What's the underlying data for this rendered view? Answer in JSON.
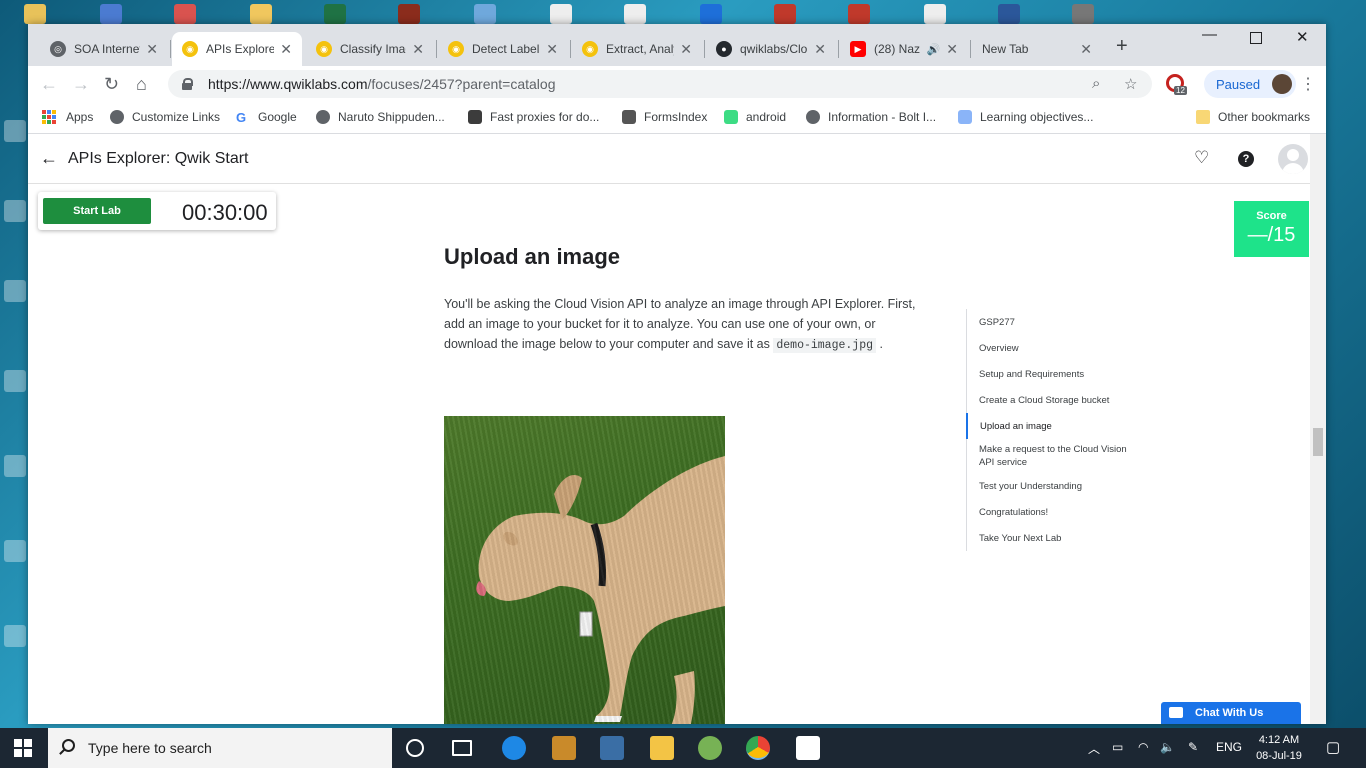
{
  "browser": {
    "tabs": [
      {
        "label": "SOA Internet",
        "active": false
      },
      {
        "label": "APIs Explorer",
        "active": true
      },
      {
        "label": "Classify Imag",
        "active": false
      },
      {
        "label": "Detect Label",
        "active": false
      },
      {
        "label": "Extract, Analy",
        "active": false
      },
      {
        "label": "qwiklabs/Clo",
        "active": false
      },
      {
        "label": "(28) Naz",
        "active": false
      },
      {
        "label": "New Tab",
        "active": false
      }
    ],
    "url_host": "https://www.qwiklabs.com",
    "url_path": "/focuses/2457?parent=catalog",
    "profile_status": "Paused",
    "extension_badge": "12",
    "bookmarks": [
      "Apps",
      "Customize Links",
      "Google",
      "Naruto Shippuden...",
      "Fast proxies for do...",
      "FormsIndex",
      "android",
      "Information - Bolt I...",
      "Learning objectives..."
    ],
    "other_bookmarks": "Other bookmarks"
  },
  "page": {
    "title": "APIs Explorer: Qwik Start",
    "start_lab": "Start Lab",
    "timer": "00:30:00",
    "score_label": "Score",
    "score_value": "—/15",
    "heading": "Upload an image",
    "paragraph_before": "You'll be asking the Cloud Vision API to analyze an image through API Explorer. First, add an image to your bucket for it to analyze. You can use one of your own, or download the image below to your computer and save it as",
    "code_filename": "demo-image.jpg",
    "paragraph_after": ".",
    "toc": [
      {
        "label": "GSP277",
        "active": false
      },
      {
        "label": "Overview",
        "active": false
      },
      {
        "label": "Setup and Requirements",
        "active": false
      },
      {
        "label": "Create a Cloud Storage bucket",
        "active": false
      },
      {
        "label": "Upload an image",
        "active": true
      },
      {
        "label": "Make a request to the Cloud Vision API service",
        "active": false
      },
      {
        "label": "Test your Understanding",
        "active": false
      },
      {
        "label": "Congratulations!",
        "active": false
      },
      {
        "label": "Take Your Next Lab",
        "active": false
      }
    ],
    "chat_button": "Chat With Us"
  },
  "taskbar": {
    "search_placeholder": "Type here to search",
    "language": "ENG",
    "time": "4:12 AM",
    "date": "08-Jul-19"
  },
  "colors": {
    "start_lab_green": "#1e8e3e",
    "score_green": "#1ee38a",
    "toc_active_blue": "#1a73e8"
  }
}
